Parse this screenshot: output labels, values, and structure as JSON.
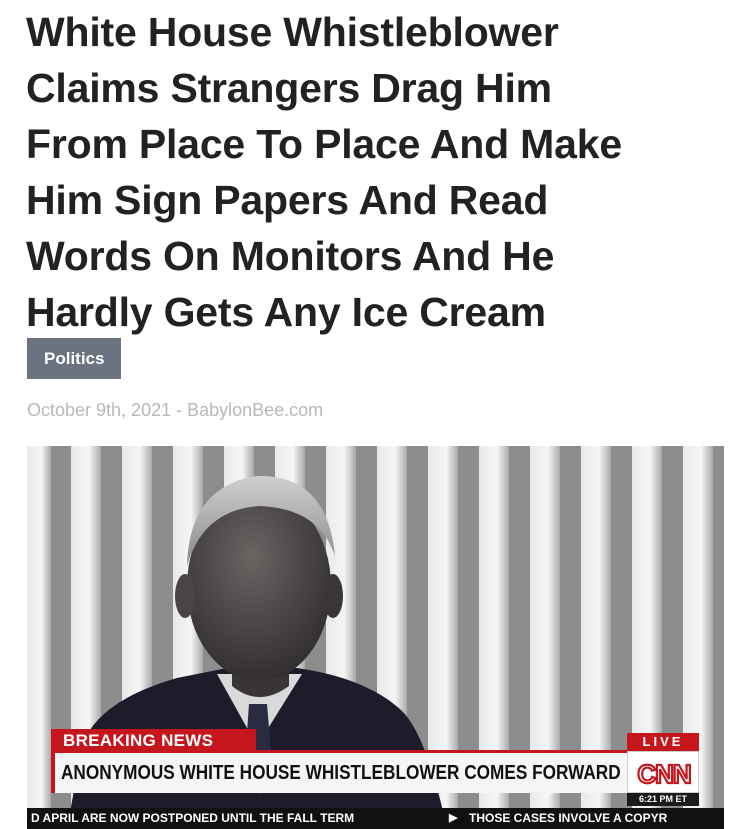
{
  "article": {
    "headline_lines": [
      "White House Whistleblower",
      "Claims Strangers Drag Him",
      "From Place To Place And Make",
      "Him Sign Papers And Read",
      "Words On Monitors And He",
      "Hardly Gets Any Ice Cream"
    ],
    "category": "Politics",
    "byline": "October 9th, 2021 - BabylonBee.com"
  },
  "broadcast": {
    "breaking_label": "BREAKING NEWS",
    "live_label": "LIVE",
    "chyron_text": "ANONYMOUS WHITE HOUSE WHISTLEBLOWER COMES FORWARD",
    "network_logo_text": "CNN",
    "time_label": "6:21 PM ET",
    "ticker_items": [
      "D APRIL ARE NOW POSTPONED UNTIL THE FALL TERM",
      "THOSE CASES INVOLVE A COPYR"
    ],
    "ticker_separator": "▶"
  },
  "colors": {
    "headline_text": "#222222",
    "badge_background": "#6b7280",
    "byline_text": "#b8b8b8",
    "breaking_red": "#c4161c",
    "ticker_background": "#111111"
  }
}
